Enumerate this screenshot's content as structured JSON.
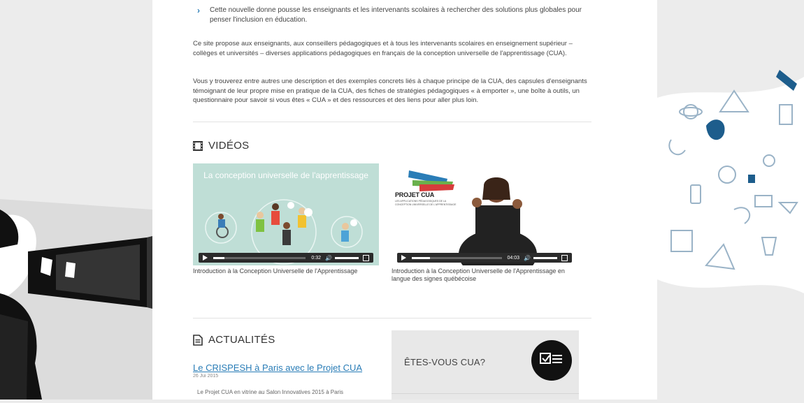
{
  "intro": {
    "bullet": "Cette nouvelle donne pousse les enseignants et les intervenants scolaires à rechercher des solutions plus globales pour penser l'inclusion en éducation.",
    "paragraph1": "Ce site propose aux enseignants, aux conseillers pédagogiques et à tous les intervenants scolaires en enseignement supérieur – collèges et universités – diverses applications pédagogiques en français de la conception universelle de l'apprentissage (CUA).",
    "paragraph2": "Vous y trouverez entre autres une description et des exemples concrets liés à chaque principe de la CUA, des capsules d'enseignants témoignant de leur propre mise en pratique de la CUA, des fiches de stratégies pédagogiques « à emporter », une boîte à outils, un questionnaire pour savoir si vous êtes « CUA » et des ressources et des liens pour aller plus loin."
  },
  "videos": {
    "heading": "VIDÉOS",
    "items": [
      {
        "thumb_title": "La conception universelle de l'apprentissage",
        "time": "0:32",
        "progress": 0.12,
        "caption": "Introduction à la Conception Universelle de l'Apprentissage"
      },
      {
        "logo": "PROJET CUA",
        "logo_sub": "LES APPLICATIONS PÉDAGOGIQUES DE LA CONCEPTION UNIVERSELLE DE L'APPRENTISSAGE",
        "time": "04:03",
        "progress": 0.2,
        "caption": "Introduction à la Conception Universelle de l'Apprentissage en langue des signes québécoise"
      }
    ]
  },
  "news": {
    "heading": "ACTUALITÉS",
    "item_title": "Le CRISPESH à Paris avec le Projet CUA",
    "item_date": "26 Jui 2015",
    "item_excerpt": "Le Projet CUA en vitrine au Salon Innovatives 2015 à Paris"
  },
  "cua_panel": {
    "label": "ÊTES-VOUS CUA?"
  },
  "icons": {
    "bullet": "chevron-right-icon",
    "videos": "film-icon",
    "news": "document-icon",
    "cua": "checklist-icon"
  },
  "colors": {
    "accent": "#2a7db7",
    "panel": "#e8e8e8",
    "badge": "#111111"
  }
}
